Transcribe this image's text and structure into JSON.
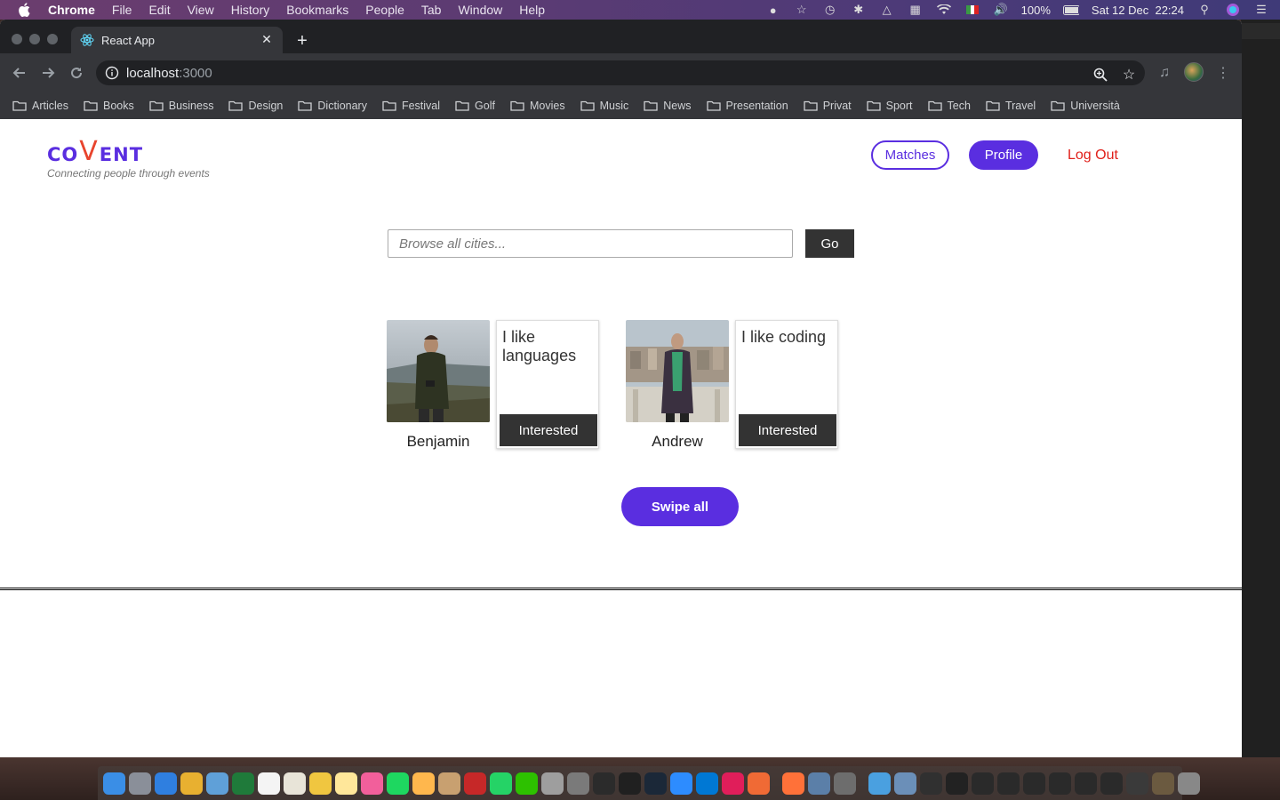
{
  "menubar": {
    "app": "Chrome",
    "items": [
      "File",
      "Edit",
      "View",
      "History",
      "Bookmarks",
      "People",
      "Tab",
      "Window",
      "Help"
    ],
    "battery": "100%",
    "clock": "Sat 12 Dec  22:24"
  },
  "browser": {
    "tab_title": "React App",
    "url_host": "localhost",
    "url_port": ":3000",
    "bookmarks": [
      "Articles",
      "Books",
      "Business",
      "Design",
      "Dictionary",
      "Festival",
      "Golf",
      "Movies",
      "Music",
      "News",
      "Presentation",
      "Privat",
      "Sport",
      "Tech",
      "Travel",
      "Università"
    ]
  },
  "app": {
    "logo": {
      "before": "CO",
      "v": "V",
      "after": "ENT"
    },
    "tagline": "Connecting people through events",
    "nav": {
      "matches": "Matches",
      "profile": "Profile",
      "logout": "Log Out"
    },
    "search": {
      "placeholder": "Browse all cities...",
      "go": "Go"
    },
    "people": [
      {
        "name": "Benjamin",
        "bio": "I like languages",
        "action": "Interested"
      },
      {
        "name": "Andrew",
        "bio": "I like coding",
        "action": "Interested"
      }
    ],
    "swipe_all": "Swipe all"
  },
  "colors": {
    "brand": "#5a2ee0",
    "logout": "#e0201a",
    "dark_button": "#333333"
  }
}
